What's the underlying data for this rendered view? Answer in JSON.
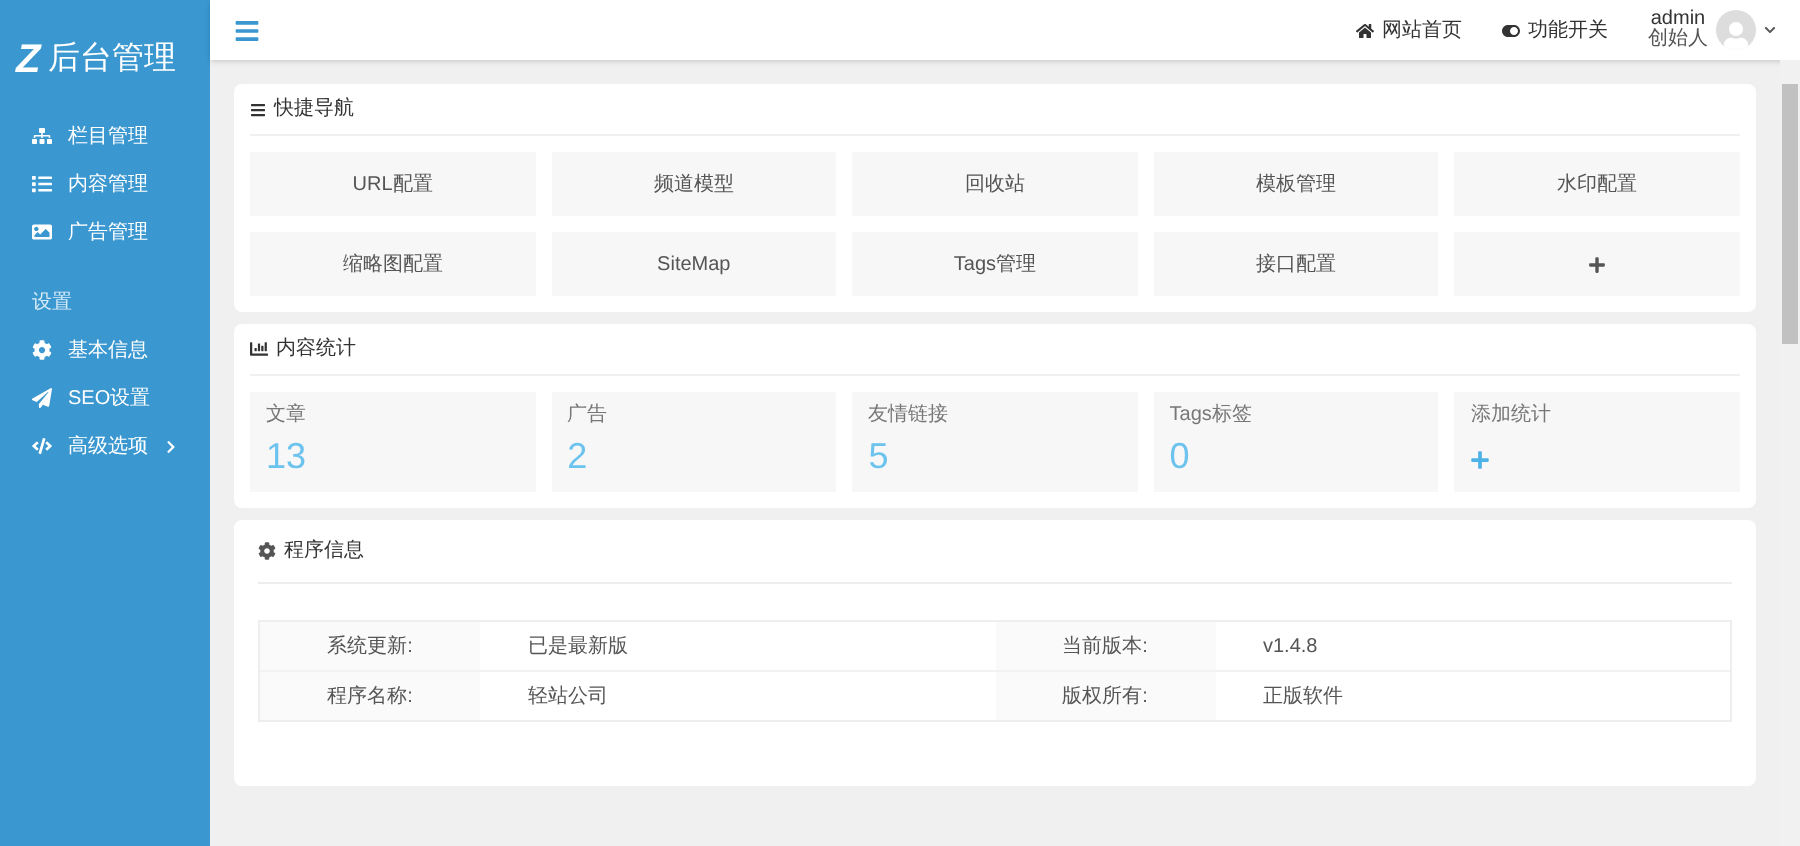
{
  "logo": {
    "mark": "Z",
    "title": "后台管理"
  },
  "sidebar": {
    "items": [
      {
        "label": "栏目管理",
        "selected": false
      },
      {
        "label": "内容管理",
        "selected": false
      },
      {
        "label": "广告管理",
        "selected": false
      }
    ],
    "section": "设置",
    "settings": [
      {
        "label": "基本信息",
        "expandable": false
      },
      {
        "label": "SEO设置",
        "expandable": false
      },
      {
        "label": "高级选项",
        "expandable": true
      }
    ]
  },
  "header": {
    "links": [
      {
        "label": "网站首页"
      },
      {
        "label": "功能开关"
      }
    ],
    "user": {
      "name": "admin",
      "role": "创始人"
    }
  },
  "quick_nav": {
    "title": "快捷导航",
    "items": [
      {
        "kind": "text",
        "label": "URL配置"
      },
      {
        "kind": "text",
        "label": "频道模型"
      },
      {
        "kind": "text",
        "label": "回收站"
      },
      {
        "kind": "text",
        "label": "模板管理"
      },
      {
        "kind": "text",
        "label": "水印配置"
      },
      {
        "kind": "text",
        "label": "缩略图配置"
      },
      {
        "kind": "text",
        "label": "SiteMap"
      },
      {
        "kind": "text",
        "label": "Tags管理"
      },
      {
        "kind": "text",
        "label": "接口配置"
      },
      {
        "kind": "add"
      }
    ]
  },
  "stats": {
    "title": "内容统计",
    "items": [
      {
        "kind": "count",
        "label": "文章",
        "value": "13"
      },
      {
        "kind": "count",
        "label": "广告",
        "value": "2"
      },
      {
        "kind": "count",
        "label": "友情链接",
        "value": "5"
      },
      {
        "kind": "count",
        "label": "Tags标签",
        "value": "0"
      },
      {
        "kind": "add",
        "label": "添加统计"
      }
    ]
  },
  "program_info": {
    "title": "程序信息",
    "rows": [
      [
        "系统更新:",
        "已是最新版",
        "当前版本:",
        "v1.4.8"
      ],
      [
        "程序名称:",
        "轻站公司",
        "版权所有:",
        "正版软件"
      ]
    ]
  }
}
